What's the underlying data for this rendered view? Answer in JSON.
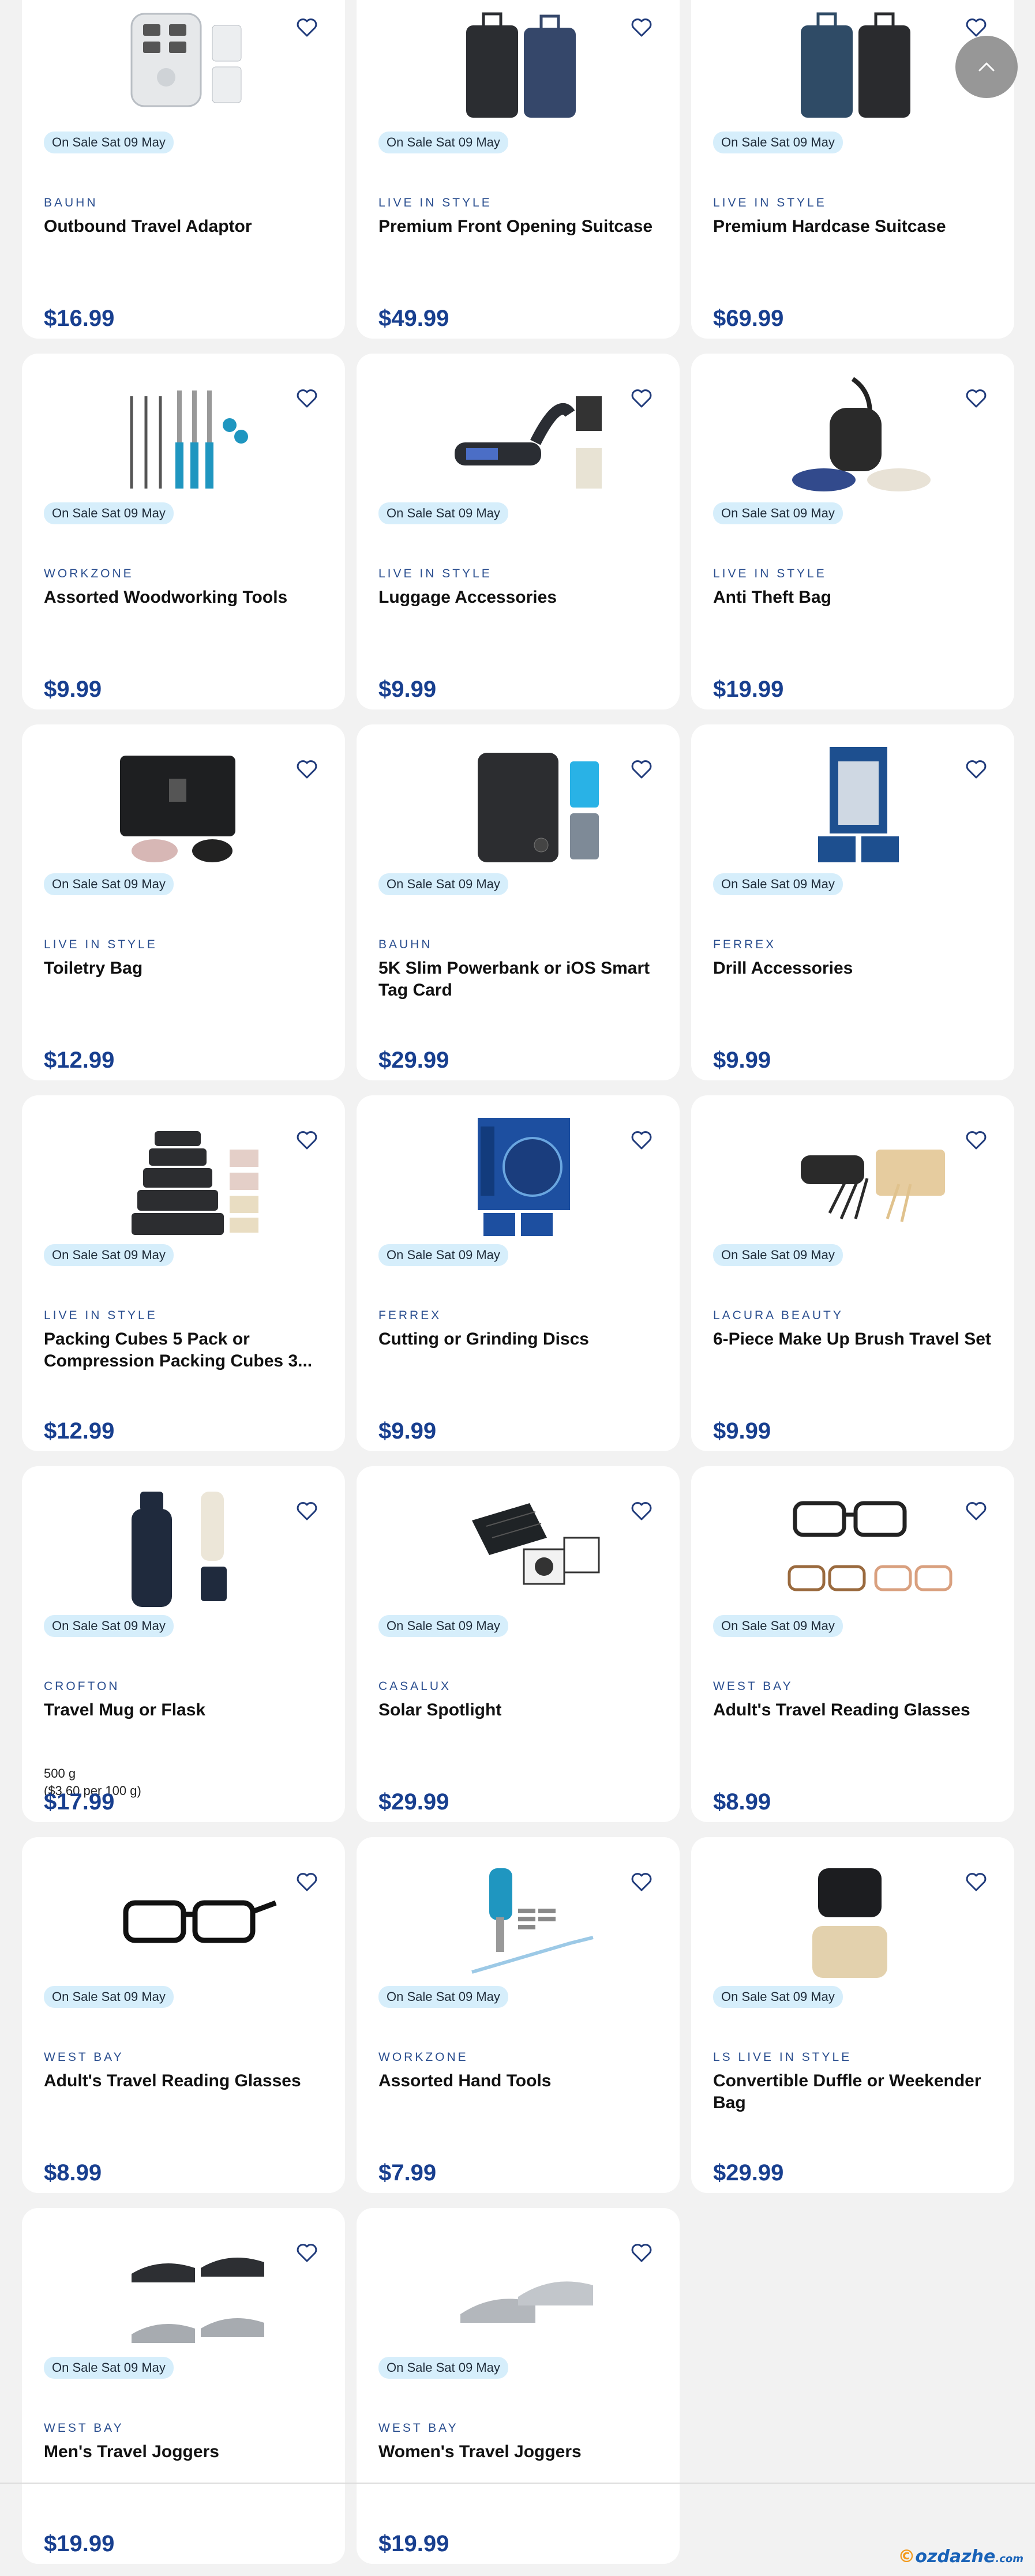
{
  "accent_color": "#183f8f",
  "sale_color": "#d6eefb",
  "products": [
    {
      "brand": "BAUHN",
      "title": "Outbound Travel Adaptor",
      "sale": "On Sale Sat 09 May",
      "price": "$16.99",
      "image": "travel-adaptor"
    },
    {
      "brand": "LIVE IN STYLE",
      "title": "Premium Front Opening Suitcase",
      "sale": "On Sale Sat 09 May",
      "price": "$49.99",
      "image": "suitcases-dark"
    },
    {
      "brand": "LIVE IN STYLE",
      "title": "Premium Hardcase Suitcase",
      "sale": "On Sale Sat 09 May",
      "price": "$69.99",
      "image": "suitcases-navy"
    },
    {
      "brand": "WORKZONE",
      "title": "Assorted Woodworking Tools",
      "sale": "On Sale Sat 09 May",
      "price": "$9.99",
      "image": "woodworking-tools"
    },
    {
      "brand": "LIVE IN STYLE",
      "title": "Luggage Accessories",
      "sale": "On Sale Sat 09 May",
      "price": "$9.99",
      "image": "luggage-scale"
    },
    {
      "brand": "LIVE IN STYLE",
      "title": "Anti Theft Bag",
      "sale": "On Sale Sat 09 May",
      "price": "$19.99",
      "image": "sling-bag"
    },
    {
      "brand": "LIVE IN STYLE",
      "title": "Toiletry Bag",
      "sale": "On Sale Sat 09 May",
      "price": "$12.99",
      "image": "toiletry-bag"
    },
    {
      "brand": "BAUHN",
      "title": "5K Slim Powerbank or iOS Smart Tag Card",
      "sale": "On Sale Sat 09 May",
      "price": "$29.99",
      "image": "powerbank"
    },
    {
      "brand": "FERREX",
      "title": "Drill Accessories",
      "sale": "On Sale Sat 09 May",
      "price": "$9.99",
      "image": "drill-accessories"
    },
    {
      "brand": "LIVE IN STYLE",
      "title": "Packing Cubes 5 Pack or Compression Packing Cubes 3...",
      "sale": "On Sale Sat 09 May",
      "price": "$12.99",
      "image": "packing-cubes"
    },
    {
      "brand": "FERREX",
      "title": "Cutting or Grinding Discs",
      "sale": "On Sale Sat 09 May",
      "price": "$9.99",
      "image": "cutting-discs"
    },
    {
      "brand": "LACURA BEAUTY",
      "title": "6-Piece Make Up Brush Travel Set",
      "sale": "On Sale Sat 09 May",
      "price": "$9.99",
      "image": "makeup-brushes"
    },
    {
      "brand": "CROFTON",
      "title": "Travel Mug or Flask",
      "sale": "On Sale Sat 09 May",
      "price": "$17.99",
      "weight": "500 g",
      "unit_price": "($3.60 per 100 g)",
      "image": "flask"
    },
    {
      "brand": "CASALUX",
      "title": "Solar Spotlight",
      "sale": "On Sale Sat 09 May",
      "price": "$29.99",
      "image": "solar-spotlight"
    },
    {
      "brand": "WEST BAY",
      "title": "Adult's Travel Reading Glasses",
      "sale": "On Sale Sat 09 May",
      "price": "$8.99",
      "image": "reading-glasses-set"
    },
    {
      "brand": "WEST BAY",
      "title": "Adult's Travel Reading Glasses",
      "sale": "On Sale Sat 09 May",
      "price": "$8.99",
      "image": "reading-glasses"
    },
    {
      "brand": "WORKZONE",
      "title": "Assorted Hand Tools",
      "sale": "On Sale Sat 09 May",
      "price": "$7.99",
      "image": "hand-tools"
    },
    {
      "brand": "LS LIVE IN STYLE",
      "title": "Convertible Duffle or Weekender Bag",
      "sale": "On Sale Sat 09 May",
      "price": "$29.99",
      "image": "duffle-bags"
    },
    {
      "brand": "WEST BAY",
      "title": "Men's Travel Joggers",
      "sale": "On Sale Sat 09 May",
      "price": "$19.99",
      "image": "mens-joggers"
    },
    {
      "brand": "WEST BAY",
      "title": "Women's Travel Joggers",
      "sale": "On Sale Sat 09 May",
      "price": "$19.99",
      "image": "womens-joggers"
    }
  ],
  "watermark": {
    "prefix": "",
    "brand": "ozdazhe",
    "suffix": ".com"
  }
}
